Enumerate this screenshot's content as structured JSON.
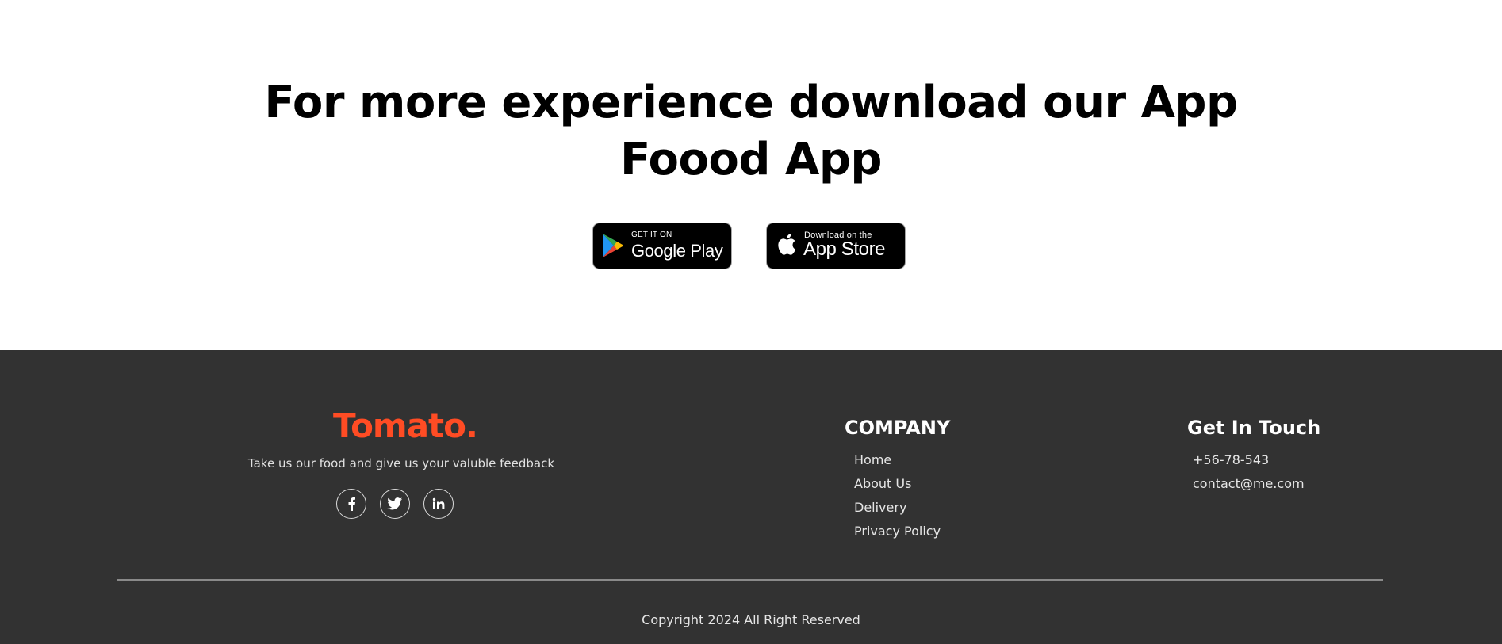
{
  "download": {
    "title_line1": "For more experience download our App",
    "title_line2": "Foood App",
    "google_play": {
      "small": "GET IT ON",
      "big": "Google Play",
      "icon": "google-play-icon"
    },
    "app_store": {
      "small": "Download on the",
      "big": "App Store",
      "icon": "apple-icon"
    }
  },
  "footer": {
    "brand": "Tomato.",
    "brand_color": "#ff4c24",
    "tagline": "Take us our food and give us your valuble feedback",
    "socials": [
      {
        "icon": "facebook-icon"
      },
      {
        "icon": "twitter-icon"
      },
      {
        "icon": "linkedin-icon"
      }
    ],
    "company": {
      "title": "COMPANY",
      "links": [
        "Home",
        "About Us",
        "Delivery",
        "Privacy Policy"
      ]
    },
    "contact": {
      "title": "Get In Touch",
      "phone": "+56-78-543",
      "email": "contact@me.com"
    },
    "copyright": "Copyright 2024 All Right Reserved",
    "background_color": "#323232"
  }
}
